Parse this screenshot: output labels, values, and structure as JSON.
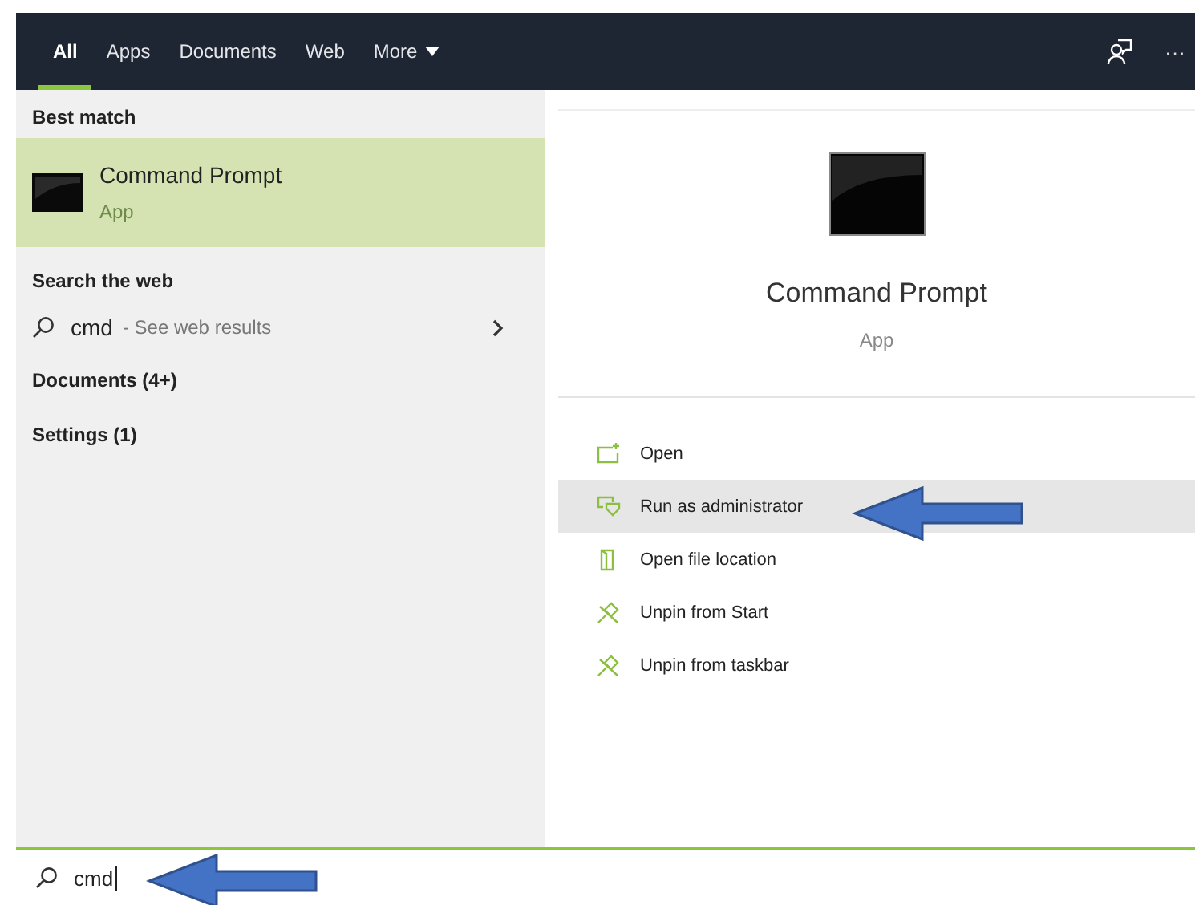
{
  "tabs": [
    {
      "label": "All",
      "selected": true
    },
    {
      "label": "Apps",
      "selected": false
    },
    {
      "label": "Documents",
      "selected": false
    },
    {
      "label": "Web",
      "selected": false
    },
    {
      "label": "More",
      "selected": false,
      "dropdown": true
    }
  ],
  "header_more": "···",
  "best_match": {
    "heading": "Best match",
    "title": "Command Prompt",
    "subtitle": "App",
    "selected": true
  },
  "web": {
    "heading": "Search the web",
    "query": "cmd",
    "hint": "- See web results"
  },
  "groups": [
    "Documents (4+)",
    "Settings (1)"
  ],
  "preview": {
    "title": "Command Prompt",
    "subtitle": "App"
  },
  "actions": [
    {
      "kind": "open",
      "label": "Open",
      "selected": false
    },
    {
      "kind": "admin",
      "label": "Run as administrator",
      "selected": true
    },
    {
      "kind": "folder",
      "label": "Open file location",
      "selected": false
    },
    {
      "kind": "unpin",
      "label": "Unpin from Start",
      "selected": false
    },
    {
      "kind": "unpin",
      "label": "Unpin from taskbar",
      "selected": false
    }
  ],
  "search": {
    "value": "cmd"
  }
}
